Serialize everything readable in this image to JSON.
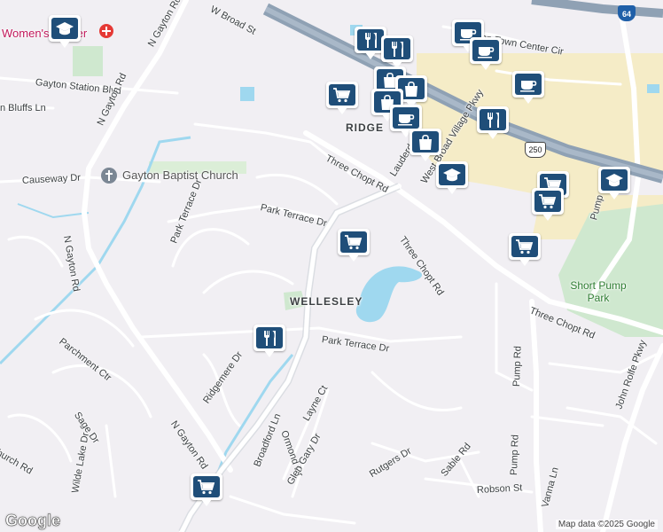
{
  "map": {
    "pois": {
      "womens_center": "Women's Center",
      "church": "Gayton Baptist Church",
      "park": "Short Pump Park"
    },
    "places": {
      "wellesley": "WELLESLEY",
      "ridge": "RIDGE"
    },
    "roads": {
      "broad": "W Broad St",
      "gayton_station": "Gayton Station Blvd",
      "bluffs": "n Bluffs Ln",
      "n_gayton_1": "N Gayton Rd",
      "n_gayton_2": "N Gayton Rd",
      "n_gayton_3": "N Gayton Rd",
      "n_gayton_4": "N Gayton Rd",
      "causeway": "Causeway Dr",
      "park_terrace_1": "Park Terrace Dr",
      "park_terrace_2": "Park Terrace Dr",
      "park_terrace_3": "Park Terrace Dr",
      "three_chopt_1": "Three Chopt Rd",
      "three_chopt_2": "Three Chopt Rd",
      "three_chopt_3": "Three Chopt Rd",
      "lauderdale": "Lauderdale",
      "westpark": "West Broad Village Pkwy",
      "town_center": "mp Town Center Cir",
      "pump_1": "Pump Rd",
      "pump_2": "Pump",
      "john_rolfe": "John Rolfe Pkwy",
      "parchment": "Parchment Ctr",
      "sage": "Sage Dr",
      "church_rd": "Church Rd",
      "ridgemere": "Ridgemere Dr",
      "ormond": "Ormond Dr",
      "layne": "Layne Ct",
      "broadford": "Broadford Ln",
      "glen_gary": "Glen Gary Dr",
      "rutgers": "Rutgers Dr",
      "sable": "Sable Rd",
      "robson": "Robson St",
      "vanna": "Vanna Ln",
      "wilde_lake": "Wilde Lake Dr"
    },
    "shields": {
      "us250": "250",
      "i64": "64"
    },
    "attribution": {
      "logo": "Google",
      "data": "Map data ©2025 Google"
    },
    "colors": {
      "background": "#f1eff3",
      "road": "#ffffff",
      "highway": "#8fa1b4",
      "water": "#9fd8ef",
      "park": "#c8e6c9",
      "commercial": "#f5ecc7",
      "marker": "#1f4e79"
    },
    "markers": [
      {
        "icon": "graduation-cap-icon"
      },
      {
        "icon": "fork-knife-icon"
      },
      {
        "icon": "fork-knife-icon"
      },
      {
        "icon": "coffee-cup-icon"
      },
      {
        "icon": "coffee-cup-icon"
      },
      {
        "icon": "coffee-cup-icon"
      },
      {
        "icon": "shopping-cart-icon"
      },
      {
        "icon": "shopping-bag-icon"
      },
      {
        "icon": "shopping-bag-icon"
      },
      {
        "icon": "shopping-bag-icon"
      },
      {
        "icon": "coffee-cup-icon"
      },
      {
        "icon": "fork-knife-icon"
      },
      {
        "icon": "shopping-bag-icon"
      },
      {
        "icon": "graduation-cap-icon"
      },
      {
        "icon": "shopping-cart-icon"
      },
      {
        "icon": "graduation-cap-icon"
      },
      {
        "icon": "shopping-cart-icon"
      },
      {
        "icon": "shopping-cart-icon"
      },
      {
        "icon": "shopping-cart-icon"
      },
      {
        "icon": "fork-knife-icon"
      },
      {
        "icon": "shopping-cart-icon"
      }
    ]
  }
}
